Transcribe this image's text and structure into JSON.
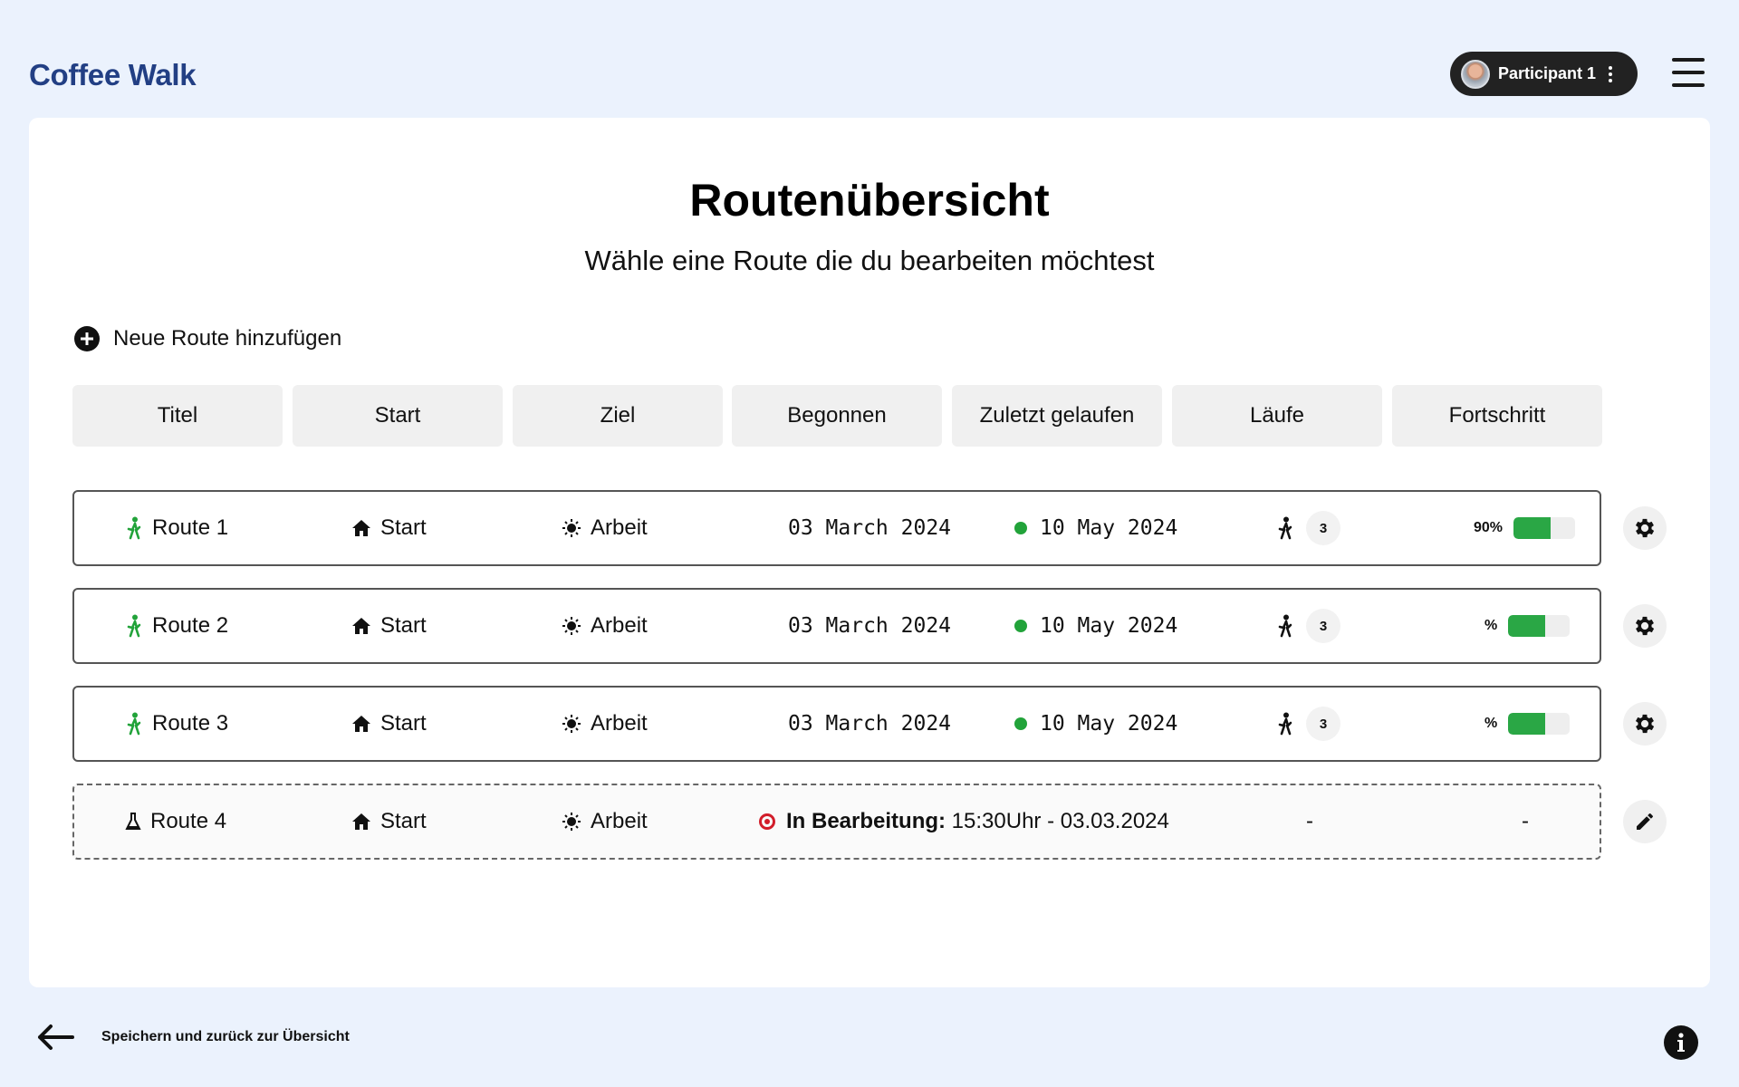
{
  "app": {
    "title": "Coffee Walk"
  },
  "user": {
    "name": "Participant 1"
  },
  "page": {
    "title": "Routenübersicht",
    "subtitle": "Wähle eine Route die du bearbeiten möchtest",
    "add_route_label": "Neue Route hinzufügen"
  },
  "columns": [
    "Titel",
    "Start",
    "Ziel",
    "Begonnen",
    "Zuletzt gelaufen",
    "Läufe",
    "Fortschritt"
  ],
  "routes": [
    {
      "title": "Route 1",
      "start": "Start",
      "goal": "Arbeit",
      "started": "03 March 2024",
      "last_walked": "10 May 2024",
      "runs": "3",
      "progress_label": "90%",
      "progress_value": 0.6,
      "status_color": "#22a33a"
    },
    {
      "title": "Route 2",
      "start": "Start",
      "goal": "Arbeit",
      "started": "03 March 2024",
      "last_walked": "10 May 2024",
      "runs": "3",
      "progress_label": "%",
      "progress_value": 0.6,
      "status_color": "#22a33a"
    },
    {
      "title": "Route 3",
      "start": "Start",
      "goal": "Arbeit",
      "started": "03 March 2024",
      "last_walked": "10 May 2024",
      "runs": "3",
      "progress_label": "%",
      "progress_value": 0.6,
      "status_color": "#22a33a"
    },
    {
      "title": "Route 4",
      "start": "Start",
      "goal": "Arbeit",
      "status_label": "In Bearbeitung:",
      "status_detail": " 15:30Uhr - 03.03.2024",
      "runs": "-",
      "progress_label": "-",
      "status_color": "#d21d2a"
    }
  ],
  "footer": {
    "back_label": "Speichern und zurück zur Übersicht"
  },
  "colors": {
    "accent": "#223f84",
    "success": "#2aa745",
    "danger": "#d21d2a",
    "background": "#ebf2fd"
  },
  "icons": {
    "walker": "walker-icon",
    "home": "home-icon",
    "goal": "sun-icon",
    "settings": "gear-icon",
    "edit": "pencil-icon",
    "back": "arrow-left-icon",
    "info": "info-icon",
    "draft": "flask-icon"
  }
}
